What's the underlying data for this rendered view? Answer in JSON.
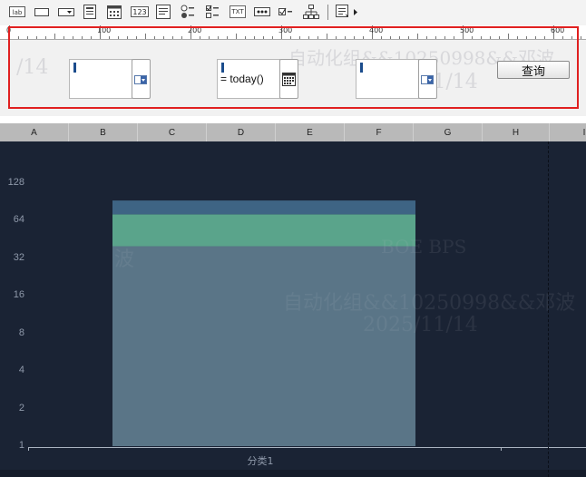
{
  "toolbar": {
    "tools": [
      {
        "name": "label-tool-icon",
        "text": "lab"
      },
      {
        "name": "textbox-tool-icon"
      },
      {
        "name": "dropdown-tool-icon"
      },
      {
        "name": "list-tool-icon"
      },
      {
        "name": "calendar-tool-icon"
      },
      {
        "name": "number-tool-icon",
        "text": "123"
      },
      {
        "name": "textarea-tool-icon"
      },
      {
        "name": "radio-tool-icon"
      },
      {
        "name": "checkbox-group-tool-icon"
      },
      {
        "name": "text-tool-icon",
        "text": "TXT"
      },
      {
        "name": "password-tool-icon",
        "text": "•••"
      },
      {
        "name": "checkbox-tool-icon"
      },
      {
        "name": "tree-tool-icon"
      },
      {
        "name": "more-tool-icon"
      }
    ]
  },
  "ruler": {
    "labels": [
      "0",
      "100",
      "200",
      "300",
      "400",
      "500",
      "600"
    ]
  },
  "params": {
    "field1": {
      "value": ""
    },
    "field2": {
      "value": "= today()"
    },
    "field3": {
      "value": ""
    },
    "query_label": "查询"
  },
  "watermark": {
    "line1": "BOE BPS",
    "line2": "自动化组&&10250998&&邓波",
    "line3": "2025/11/14"
  },
  "sheet": {
    "columns": [
      "A",
      "B",
      "C",
      "D",
      "E",
      "F",
      "G",
      "H",
      "I"
    ]
  },
  "colors": {
    "chart_bg": "#1a2334",
    "bar_body": "#5a7587",
    "bar_mid": "#5aa48b",
    "bar_top": "#3e6484",
    "panel_border": "#e02020"
  },
  "chart_data": {
    "type": "bar",
    "categories": [
      "分类1"
    ],
    "y_scale": "log2",
    "ylim": [
      1,
      128
    ],
    "y_ticks": [
      "128",
      "64",
      "32",
      "16",
      "8",
      "4",
      "2",
      "1"
    ],
    "series": [
      {
        "name": "",
        "values": [
          40
        ],
        "color": "#5a7587"
      },
      {
        "name": "",
        "values": [
          32
        ],
        "color": "#5aa48b"
      },
      {
        "name": "",
        "values": [
          21
        ],
        "color": "#3e6484"
      }
    ],
    "stacked": true,
    "grid": false
  }
}
